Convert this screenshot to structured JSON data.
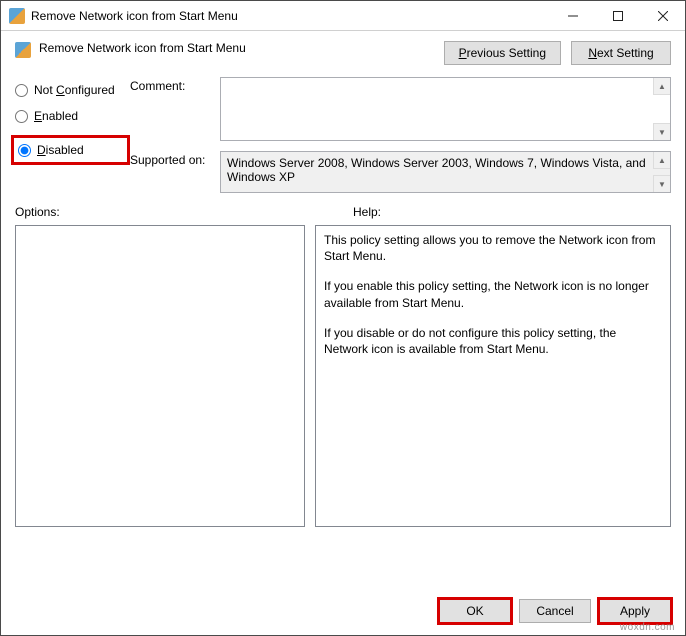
{
  "window": {
    "title": "Remove Network icon from Start Menu"
  },
  "header": {
    "subtitle": "Remove Network icon from Start Menu",
    "previous_setting": "Previous Setting",
    "next_setting": "Next Setting"
  },
  "radios": {
    "not_configured": "Not Configured",
    "enabled": "Enabled",
    "disabled": "Disabled",
    "selected": "disabled"
  },
  "labels": {
    "comment": "Comment:",
    "supported_on": "Supported on:",
    "options": "Options:",
    "help": "Help:"
  },
  "supported_text": "Windows Server 2008, Windows Server 2003, Windows 7, Windows Vista, and Windows XP",
  "help_paragraphs": [
    "This policy setting allows you to remove the Network icon from Start Menu.",
    "If you enable this policy setting, the Network icon is no longer available from Start Menu.",
    "If you disable or do not configure this policy setting, the Network icon is available from Start Menu."
  ],
  "footer": {
    "ok": "OK",
    "cancel": "Cancel",
    "apply": "Apply"
  },
  "watermark": "woxdn.com"
}
